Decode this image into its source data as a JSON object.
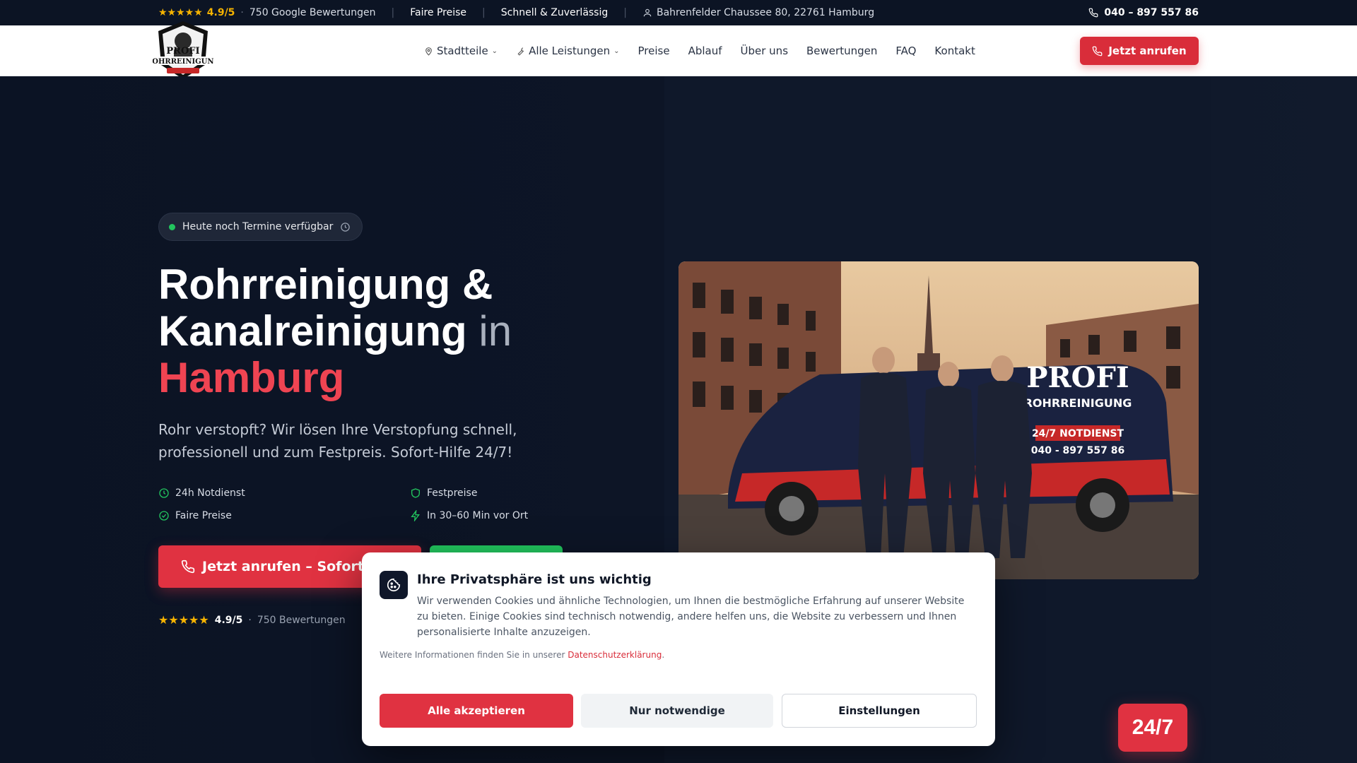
{
  "topbar": {
    "rating": "4.9/5",
    "reviews": "750 Google Bewertungen",
    "fair_prices": "Faire Preise",
    "fast": "Schnell & Zuverlässig",
    "address": "Bahrenfelder Chaussee 80, 22761 Hamburg",
    "phone": "040 – 897 557 86"
  },
  "nav": {
    "items": [
      {
        "label": "Stadtteile",
        "icon": "map-pin-icon",
        "dropdown": true
      },
      {
        "label": "Alle Leistungen",
        "icon": "wrench-icon",
        "dropdown": true
      },
      {
        "label": "Preise"
      },
      {
        "label": "Ablauf"
      },
      {
        "label": "Über uns"
      },
      {
        "label": "Bewertungen"
      },
      {
        "label": "FAQ"
      },
      {
        "label": "Kontakt"
      }
    ],
    "cta": "Jetzt anrufen"
  },
  "hero": {
    "badge": "Heute noch Termine verfügbar",
    "title_line1": "Rohrreinigung &",
    "title_line2": "Kanalreinigung",
    "title_in": "in",
    "title_city": "Hamburg",
    "lead": "Rohr verstopft? Wir lösen Ihre Verstopfung schnell, professionell und zum Festpreis. Sofort-Hilfe 24/7!",
    "features": [
      "24h Notdienst",
      "Festpreise",
      "Faire Preise",
      "In 30–60 Min vor Ort"
    ],
    "cta_main": "Jetzt anrufen – Sofort-Hilfe",
    "rating": "4.9/5",
    "reviews": "750 Bewertungen",
    "badge_247": "24/7"
  },
  "photo": {
    "van_brand": "PROFI",
    "van_sub": "ROHRREINIGUNG",
    "van_notdienst": "24/7 NOTDIENST",
    "van_phone": "040 - 897 557 86"
  },
  "cookie": {
    "title": "Ihre Privatsphäre ist uns wichtig",
    "text": "Wir verwenden Cookies und ähnliche Technologien, um Ihnen die bestmögliche Erfahrung auf unserer Website zu bieten. Einige Cookies sind technisch notwendig, andere helfen uns, die Website zu verbessern und Ihnen personalisierte Inhalte anzuzeigen.",
    "more_prefix": "Weitere Informationen finden Sie in unserer",
    "more_link": "Datenschutzerklärung",
    "more_suffix": ".",
    "accept": "Alle akzeptieren",
    "necessary": "Nur notwendige",
    "settings": "Einstellungen"
  },
  "colors": {
    "accent": "#e03241",
    "dark_bg": "#0d1526",
    "star": "#f5b301",
    "green": "#22c55e"
  }
}
